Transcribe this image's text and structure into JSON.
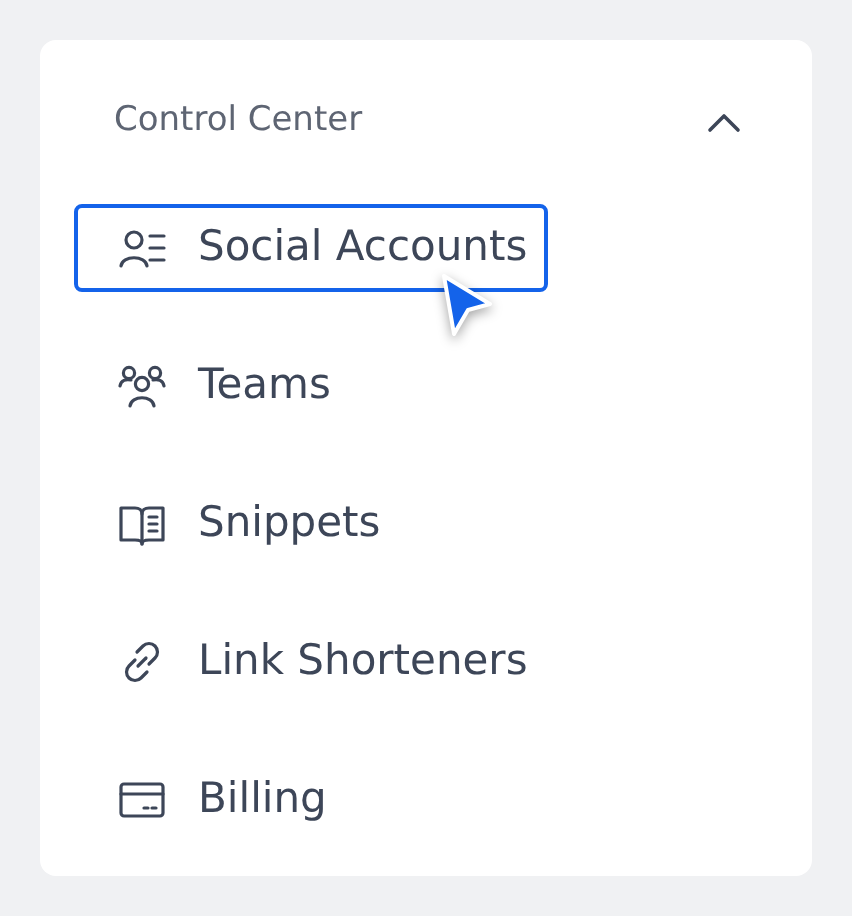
{
  "panel": {
    "title": "Control Center",
    "expanded": true,
    "items": [
      {
        "label": "Social Accounts",
        "selected": true
      },
      {
        "label": "Teams",
        "selected": false
      },
      {
        "label": "Snippets",
        "selected": false
      },
      {
        "label": "Link Shorteners",
        "selected": false
      },
      {
        "label": "Billing",
        "selected": false
      }
    ]
  }
}
